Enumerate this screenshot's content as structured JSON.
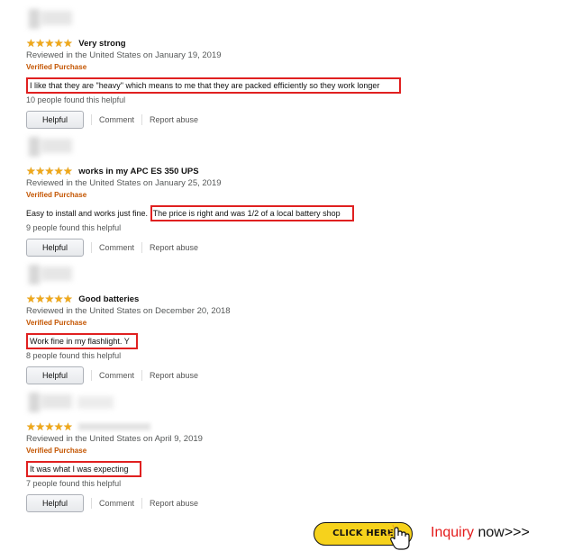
{
  "reviews": [
    {
      "stars": "★★★★★",
      "title": "Very strong",
      "meta": "Reviewed in the United States on January 19, 2019",
      "verified": "Verified Purchase",
      "body_plain": "",
      "body_highlight": "I like that they are \"heavy\" which means to me that they are packed efficiently so they work longer",
      "helpful_text": "10 people found this helpful"
    },
    {
      "stars": "★★★★★",
      "title": "works in my APC ES 350 UPS",
      "meta": "Reviewed in the United States on January 25, 2019",
      "verified": "Verified Purchase",
      "body_plain": "Easy to install and works just fine.",
      "body_highlight": "The price is right and was 1/2 of a local battery shop",
      "helpful_text": "9 people found this helpful"
    },
    {
      "stars": "★★★★★",
      "title": "Good batteries",
      "meta": "Reviewed in the United States on December 20, 2018",
      "verified": "Verified Purchase",
      "body_plain": "",
      "body_highlight": "Work fine in my flashlight. Y",
      "helpful_text": "8 people found this helpful"
    },
    {
      "stars": "★★★★★",
      "title": "",
      "meta": "Reviewed in the United States on April 9, 2019",
      "verified": "Verified Purchase",
      "body_plain": "",
      "body_highlight": "It was what I was expecting",
      "helpful_text": "7 people found this helpful"
    }
  ],
  "actions": {
    "helpful_label": "Helpful",
    "comment_label": "Comment",
    "report_label": "Report abuse"
  },
  "footer": {
    "click_here": "CLICK HERE",
    "inquiry": "Inquiry",
    "now": "now>>>"
  },
  "colors": {
    "star": "#f0a819",
    "verified": "#c45500",
    "highlight_border": "#e02020",
    "cta_yellow": "#f6d21c",
    "inquiry_red": "#e41c1c"
  }
}
